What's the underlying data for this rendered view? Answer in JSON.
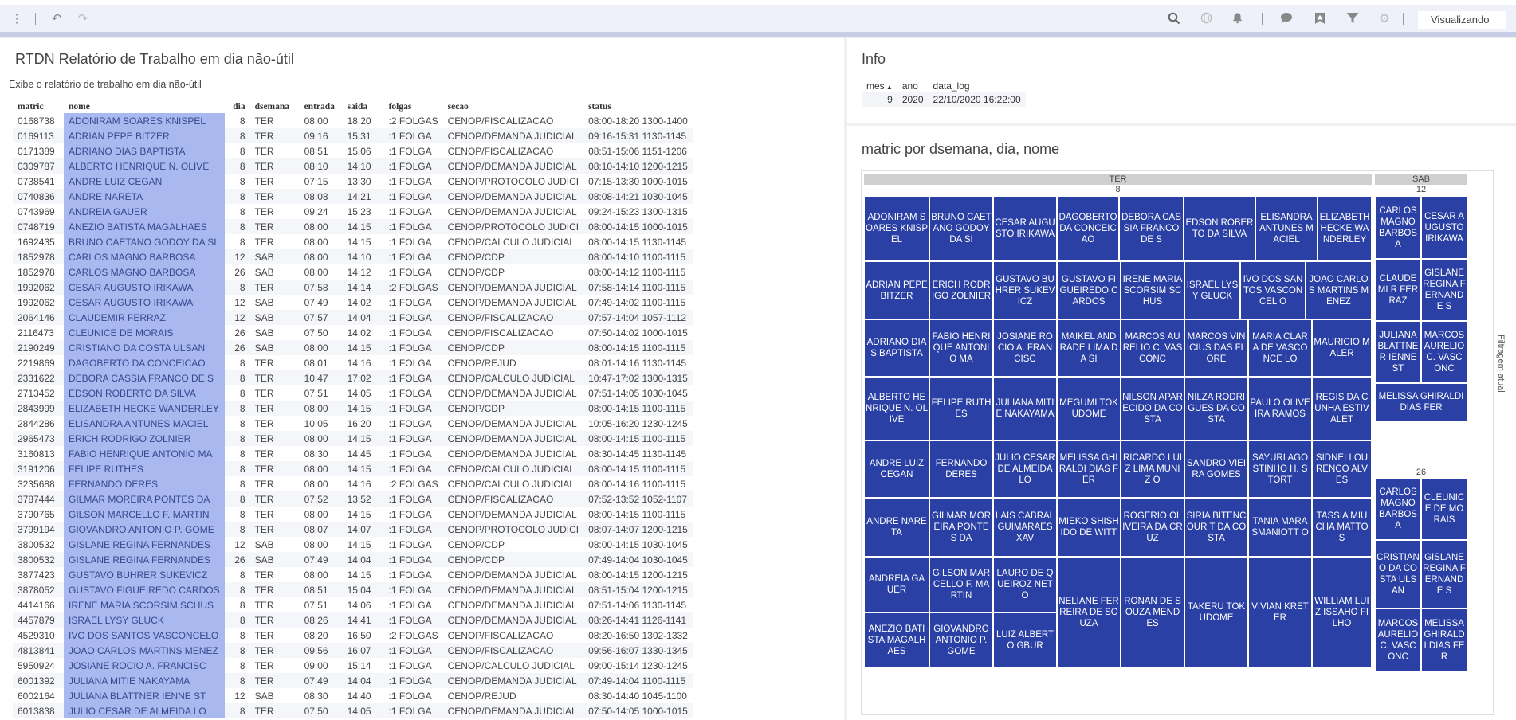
{
  "toolbar": {
    "view_label": "Visualizando"
  },
  "report": {
    "title": "RTDN Relatório de Trabalho em dia não-útil",
    "subtitle": "Exibe o relatório de trabalho em dia não-útil",
    "columns": [
      "matric",
      "nome",
      "dia",
      "dsemana",
      "entrada",
      "saida",
      "folgas",
      "secao",
      "status"
    ],
    "rows": [
      [
        "0168738",
        "ADONIRAM SOARES KNISPEL",
        "8",
        "TER",
        "08:00",
        "18:20",
        ":2 FOLGAS",
        "CENOP/FISCALIZACAO",
        "08:00-18:20 1300-1400"
      ],
      [
        "0169113",
        "ADRIAN PEPE BITZER",
        "8",
        "TER",
        "09:16",
        "15:31",
        ":1 FOLGA",
        "CENOP/DEMANDA JUDICIAL",
        "09:16-15:31 1130-1145"
      ],
      [
        "0171389",
        "ADRIANO DIAS BAPTISTA",
        "8",
        "TER",
        "08:51",
        "15:06",
        ":1 FOLGA",
        "CENOP/FISCALIZACAO",
        "08:51-15:06 1151-1206"
      ],
      [
        "0309787",
        "ALBERTO HENRIQUE N. OLIVE",
        "8",
        "TER",
        "08:10",
        "14:10",
        ":1 FOLGA",
        "CENOP/DEMANDA JUDICIAL",
        "08:10-14:10 1200-1215"
      ],
      [
        "0738541",
        "ANDRE LUIZ CEGAN",
        "8",
        "TER",
        "07:15",
        "13:30",
        ":1 FOLGA",
        "CENOP/PROTOCOLO JUDICI",
        "07:15-13:30 1000-1015"
      ],
      [
        "0740836",
        "ANDRE NARETA",
        "8",
        "TER",
        "08:08",
        "14:21",
        ":1 FOLGA",
        "CENOP/DEMANDA JUDICIAL",
        "08:08-14:21 1030-1045"
      ],
      [
        "0743969",
        "ANDREIA GAUER",
        "8",
        "TER",
        "09:24",
        "15:23",
        ":1 FOLGA",
        "CENOP/DEMANDA JUDICIAL",
        "09:24-15:23 1300-1315"
      ],
      [
        "0748719",
        "ANEZIO BATISTA MAGALHAES",
        "8",
        "TER",
        "08:00",
        "14:15",
        ":1 FOLGA",
        "CENOP/PROTOCOLO JUDICI",
        "08:00-14:15 1000-1015"
      ],
      [
        "1692435",
        "BRUNO CAETANO GODOY DA SI",
        "8",
        "TER",
        "08:00",
        "14:15",
        ":1 FOLGA",
        "CENOP/CALCULO JUDICIAL",
        "08:00-14:15 1130-1145"
      ],
      [
        "1852978",
        "CARLOS MAGNO BARBOSA",
        "12",
        "SAB",
        "08:00",
        "14:10",
        ":1 FOLGA",
        "CENOP/CDP",
        "08:00-14:10 1100-1115"
      ],
      [
        "1852978",
        "CARLOS MAGNO BARBOSA",
        "26",
        "SAB",
        "08:00",
        "14:12",
        ":1 FOLGA",
        "CENOP/CDP",
        "08:00-14:12 1100-1115"
      ],
      [
        "1992062",
        "CESAR AUGUSTO IRIKAWA",
        "8",
        "TER",
        "07:58",
        "14:14",
        ":2 FOLGAS",
        "CENOP/DEMANDA JUDICIAL",
        "07:58-14:14 1100-1115"
      ],
      [
        "1992062",
        "CESAR AUGUSTO IRIKAWA",
        "12",
        "SAB",
        "07:49",
        "14:02",
        ":1 FOLGA",
        "CENOP/DEMANDA JUDICIAL",
        "07:49-14:02 1100-1115"
      ],
      [
        "2064146",
        "CLAUDEMIR FERRAZ",
        "12",
        "SAB",
        "07:57",
        "14:04",
        ":1 FOLGA",
        "CENOP/FISCALIZACAO",
        "07:57-14:04 1057-1112"
      ],
      [
        "2116473",
        "CLEUNICE DE MORAIS",
        "26",
        "SAB",
        "07:50",
        "14:02",
        ":1 FOLGA",
        "CENOP/FISCALIZACAO",
        "07:50-14:02 1000-1015"
      ],
      [
        "2190249",
        "CRISTIANO DA COSTA ULSAN",
        "26",
        "SAB",
        "08:00",
        "14:15",
        ":1 FOLGA",
        "CENOP/CDP",
        "08:00-14:15 1100-1115"
      ],
      [
        "2219869",
        "DAGOBERTO DA CONCEICAO",
        "8",
        "TER",
        "08:01",
        "14:16",
        ":1 FOLGA",
        "CENOP/REJUD",
        "08:01-14:16 1130-1145"
      ],
      [
        "2331622",
        "DEBORA CASSIA FRANCO DE S",
        "8",
        "TER",
        "10:47",
        "17:02",
        ":1 FOLGA",
        "CENOP/CALCULO JUDICIAL",
        "10:47-17:02 1300-1315"
      ],
      [
        "2713452",
        "EDSON ROBERTO DA SILVA",
        "8",
        "TER",
        "07:51",
        "14:05",
        ":1 FOLGA",
        "CENOP/DEMANDA JUDICIAL",
        "07:51-14:05 1030-1045"
      ],
      [
        "2843999",
        "ELIZABETH HECKE WANDERLEY",
        "8",
        "TER",
        "08:00",
        "14:15",
        ":1 FOLGA",
        "CENOP/CDP",
        "08:00-14:15 1100-1115"
      ],
      [
        "2844286",
        "ELISANDRA ANTUNES MACIEL",
        "8",
        "TER",
        "10:05",
        "16:20",
        ":1 FOLGA",
        "CENOP/DEMANDA JUDICIAL",
        "10:05-16:20 1230-1245"
      ],
      [
        "2965473",
        "ERICH RODRIGO ZOLNIER",
        "8",
        "TER",
        "08:00",
        "14:15",
        ":1 FOLGA",
        "CENOP/DEMANDA JUDICIAL",
        "08:00-14:15 1100-1115"
      ],
      [
        "3160813",
        "FABIO HENRIQUE ANTONIO MA",
        "8",
        "TER",
        "08:30",
        "14:45",
        ":1 FOLGA",
        "CENOP/DEMANDA JUDICIAL",
        "08:30-14:45 1130-1145"
      ],
      [
        "3191206",
        "FELIPE RUTHES",
        "8",
        "TER",
        "08:00",
        "14:15",
        ":1 FOLGA",
        "CENOP/CALCULO JUDICIAL",
        "08:00-14:15 1100-1115"
      ],
      [
        "3235688",
        "FERNANDO DERES",
        "8",
        "TER",
        "08:00",
        "14:16",
        ":2 FOLGAS",
        "CENOP/CALCULO JUDICIAL",
        "08:00-14:16 1100-1115"
      ],
      [
        "3787444",
        "GILMAR MOREIRA PONTES DA",
        "8",
        "TER",
        "07:52",
        "13:52",
        ":1 FOLGA",
        "CENOP/FISCALIZACAO",
        "07:52-13:52 1052-1107"
      ],
      [
        "3790765",
        "GILSON MARCELLO F. MARTIN",
        "8",
        "TER",
        "08:00",
        "14:15",
        ":1 FOLGA",
        "CENOP/DEMANDA JUDICIAL",
        "08:00-14:15 1100-1115"
      ],
      [
        "3799194",
        "GIOVANDRO ANTONIO P. GOME",
        "8",
        "TER",
        "08:07",
        "14:07",
        ":1 FOLGA",
        "CENOP/PROTOCOLO JUDICI",
        "08:07-14:07 1200-1215"
      ],
      [
        "3800532",
        "GISLANE REGINA FERNANDES",
        "12",
        "SAB",
        "08:00",
        "14:15",
        ":1 FOLGA",
        "CENOP/CDP",
        "08:00-14:15 1030-1045"
      ],
      [
        "3800532",
        "GISLANE REGINA FERNANDES",
        "26",
        "SAB",
        "07:49",
        "14:04",
        ":1 FOLGA",
        "CENOP/CDP",
        "07:49-14:04 1030-1045"
      ],
      [
        "3877423",
        "GUSTAVO BUHRER SUKEVICZ",
        "8",
        "TER",
        "08:00",
        "14:15",
        ":1 FOLGA",
        "CENOP/DEMANDA JUDICIAL",
        "08:00-14:15 1200-1215"
      ],
      [
        "3878052",
        "GUSTAVO FIGUEIREDO CARDOS",
        "8",
        "TER",
        "08:51",
        "15:04",
        ":1 FOLGA",
        "CENOP/DEMANDA JUDICIAL",
        "08:51-15:04 1200-1215"
      ],
      [
        "4414166",
        "IRENE MARIA SCORSIM SCHUS",
        "8",
        "TER",
        "07:51",
        "14:06",
        ":1 FOLGA",
        "CENOP/DEMANDA JUDICIAL",
        "07:51-14:06 1130-1145"
      ],
      [
        "4457879",
        "ISRAEL LYSY GLUCK",
        "8",
        "TER",
        "08:26",
        "14:41",
        ":1 FOLGA",
        "CENOP/DEMANDA JUDICIAL",
        "08:26-14:41 1126-1141"
      ],
      [
        "4529310",
        "IVO DOS SANTOS VASCONCELO",
        "8",
        "TER",
        "08:20",
        "16:50",
        ":2 FOLGAS",
        "CENOP/FISCALIZACAO",
        "08:20-16:50 1302-1332"
      ],
      [
        "4813841",
        "JOAO CARLOS MARTINS MENEZ",
        "8",
        "TER",
        "09:56",
        "16:07",
        ":1 FOLGA",
        "CENOP/FISCALIZACAO",
        "09:56-16:07 1330-1345"
      ],
      [
        "5950924",
        "JOSIANE ROCIO A. FRANCISC",
        "8",
        "TER",
        "09:00",
        "15:14",
        ":1 FOLGA",
        "CENOP/CALCULO JUDICIAL",
        "09:00-15:14 1230-1245"
      ],
      [
        "6001392",
        "JULIANA MITIE NAKAYAMA",
        "8",
        "TER",
        "07:49",
        "14:04",
        ":1 FOLGA",
        "CENOP/DEMANDA JUDICIAL",
        "07:49-14:04 1100-1115"
      ],
      [
        "6002164",
        "JULIANA BLATTNER IENNE ST",
        "12",
        "SAB",
        "08:30",
        "14:40",
        ":1 FOLGA",
        "CENOP/REJUD",
        "08:30-14:40 1045-1100"
      ],
      [
        "6013838",
        "JULIO CESAR DE ALMEIDA LO",
        "8",
        "TER",
        "07:50",
        "14:05",
        ":1 FOLGA",
        "CENOP/DEMANDA JUDICIAL",
        "07:50-14:05 1000-1015"
      ]
    ]
  },
  "info": {
    "title": "Info",
    "columns": [
      "mes",
      "ano",
      "data_log"
    ],
    "row": [
      "9",
      "2020",
      "22/10/2020 16:22:00"
    ]
  },
  "treemap": {
    "title": "matric por dsemana, dia, nome",
    "side_label": "Filtragem atual",
    "groups": [
      {
        "dsemana": "TER",
        "dia": "8"
      },
      {
        "dsemana": "SAB",
        "dia": "12"
      },
      {
        "dsemana": "SAB",
        "dia": "26"
      }
    ],
    "ter8_tiles": [
      "ADONIRAM SOARES KNISPEL",
      "BRUNO CAETANO GODOY DA SI",
      "CESAR AUGUSTO IRIKAWA",
      "DAGOBERTO DA CONCEICAO",
      "DEBORA CASSIA FRANCO DE S",
      "EDSON ROBERTO DA SILVA",
      "ELISANDRA ANTUNES MACIEL",
      "ELIZABETH HECKE WANDERLEY",
      "ADRIAN PEPE BITZER",
      "ERICH RODRIGO ZOLNIER",
      "GUSTAVO BUHRER SUKEVICZ",
      "GUSTAVO FIGUEIREDO CARDOS",
      "IRENE MARIA SCORSIM SCHUS",
      "ISRAEL LYSY GLUCK",
      "IVO DOS SANTOS VASCONCEL O",
      "JOAO CARLOS MARTINS MENEZ",
      "ADRIANO DIAS BAPTISTA",
      "FABIO HENRIQUE ANTONIO MA",
      "JOSIANE ROCIO A. FRANCISC",
      "MAIKEL ANDRADE LIMA DA SI",
      "MARCOS AURELIO C. VASCONC",
      "MARCOS VINICIUS DAS FLORE",
      "MARIA CLARA DE VASCONCE LO",
      "MAURICIO MALER",
      "ALBERTO HENRIQUE N. OLIVE",
      "FELIPE RUTHES",
      "JULIANA MITIE NAKAYAMA",
      "MEGUMI TOKUDOME",
      "NILSON APARECIDO DA COSTA",
      "NILZA RODRIGUES DA COSTA",
      "PAULO OLIVEIRA RAMOS",
      "REGIS DA CUNHA ESTIVALET",
      "ANDRE LUIZ CEGAN",
      "FERNANDO DERES",
      "JULIO CESAR DE ALMEIDA LO",
      "MELISSA GHIRALDI DIAS FER",
      "RICARDO LUIZ LIMA MUNIZ O",
      "SANDRO VIEIRA GOMES",
      "SAYURI AGOSTINHO H. STORT",
      "SIDNEI LOURENCO ALVES",
      "ANDRE NARETA",
      "GILMAR MOREIRA PONTES DA",
      "LAIS CABRAL GUIMARAES XAV",
      "MIEKO SHISHIDO DE WITT",
      "ROGERIO OLIVEIRA DA CRUZ",
      "SIRIA BITENCOUR T DA COSTA",
      "TANIA MARA SMANIOTT O",
      "TASSIA MIUCHA MATTOS",
      "ANDREIA GAUER",
      "GILSON MARCELLO F. MARTIN",
      "LAURO DE QUEIROZ NETO",
      "NELIANE FERREIRA DE SOUZA",
      "RONAN DE SOUZA MENDES",
      "TAKERU TOKUDOME",
      "VIVIAN KRETER",
      "WILLIAM LUIZ ISSAHO FILHO",
      "ANEZIO BATISTA MAGALHAES",
      "GIOVANDRO ANTONIO P. GOME",
      "LUIZ ALBERTO GBUR"
    ],
    "sab12_tiles": [
      "CARLOS MAGNO BARBOSA",
      "CESAR AUGUSTO IRIKAWA",
      "CLAUDEMI R FERRAZ",
      "GISLANE REGINA FERNANDE S",
      "JULIANA BLATTNER IENNE ST",
      "MARCOS AURELIO C. VASCONC",
      "MELISSA GHIRALDI DIAS FER"
    ],
    "sab26_tiles": [
      "CARLOS MAGNO BARBOSA",
      "CLEUNICE DE MORAIS",
      "CRISTIANO DA COSTA ULSAN",
      "GISLANE REGINA FERNANDE S",
      "MARCOS AURELIO C. VASCONC",
      "MELISSA GHIRALDI DIAS FER"
    ]
  }
}
